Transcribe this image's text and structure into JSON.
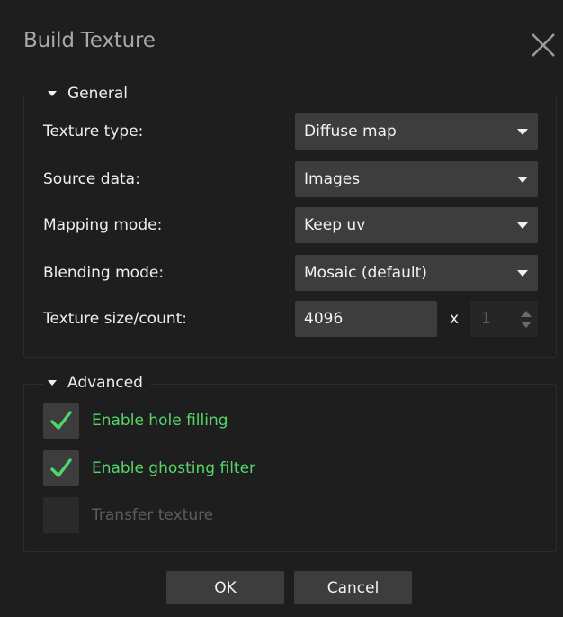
{
  "dialog": {
    "title": "Build Texture"
  },
  "general": {
    "legend": "General",
    "rows": [
      {
        "label": "Texture type:",
        "value": "Diffuse map"
      },
      {
        "label": "Source data:",
        "value": "Images"
      },
      {
        "label": "Mapping mode:",
        "value": "Keep uv"
      },
      {
        "label": "Blending mode:",
        "value": "Mosaic (default)"
      }
    ],
    "size": {
      "label": "Texture size/count:",
      "value": "4096",
      "times": "x",
      "count": "1"
    }
  },
  "advanced": {
    "legend": "Advanced",
    "options": [
      {
        "label": "Enable hole filling",
        "checked": true,
        "enabled": true
      },
      {
        "label": "Enable ghosting filter",
        "checked": true,
        "enabled": true
      },
      {
        "label": "Transfer texture",
        "checked": false,
        "enabled": false
      }
    ]
  },
  "buttons": {
    "ok": "OK",
    "cancel": "Cancel"
  },
  "colors": {
    "background": "#1e1e1e",
    "control": "#3d3d3d",
    "checked_text": "#56d56a",
    "disabled_text": "#5d5d5d",
    "check_mark": "#4fd868"
  }
}
